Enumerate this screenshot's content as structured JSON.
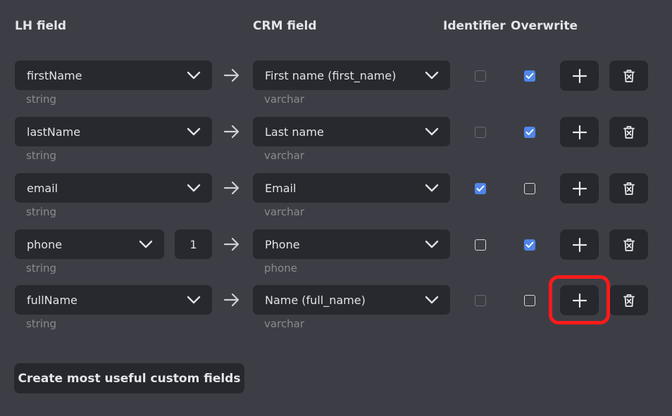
{
  "headers": {
    "lh_field": "LH field",
    "crm_field": "CRM field",
    "identifier": "Identifier",
    "overwrite": "Overwrite"
  },
  "rows": [
    {
      "lh_field": "firstName",
      "lh_type": "string",
      "crm_field": "First name (first_name)",
      "crm_type": "varchar",
      "identifier": false,
      "overwrite": true
    },
    {
      "lh_field": "lastName",
      "lh_type": "string",
      "crm_field": "Last name",
      "crm_type": "varchar",
      "identifier": false,
      "overwrite": true
    },
    {
      "lh_field": "email",
      "lh_type": "string",
      "crm_field": "Email",
      "crm_type": "varchar",
      "identifier": true,
      "overwrite": false
    },
    {
      "lh_field": "phone",
      "lh_type": "string",
      "index": "1",
      "crm_field": "Phone",
      "crm_type": "phone",
      "identifier": false,
      "overwrite": true
    },
    {
      "lh_field": "fullName",
      "lh_type": "string",
      "crm_field": "Name (full_name)",
      "crm_type": "varchar",
      "identifier": false,
      "overwrite": false
    }
  ],
  "create_button_label": "Create most useful custom fields",
  "colors": {
    "background": "#3d3e45",
    "control": "#28292e",
    "checkbox_checked": "#4f86e8",
    "highlight": "#ff1a1a"
  },
  "icons": {
    "dropdown": "chevron-down-icon",
    "mapping": "arrow-right-icon",
    "add": "plus-icon",
    "delete": "trash-icon"
  }
}
